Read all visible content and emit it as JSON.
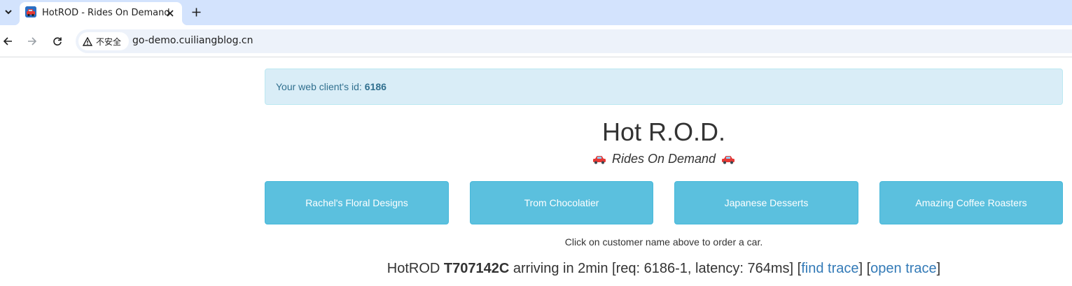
{
  "browser": {
    "tab_title": "HotROD - Rides On Demand",
    "security_label": "不安全",
    "url": "go-demo.cuiliangblog.cn",
    "icons": [
      "tab-search-icon",
      "favicon-icon",
      "close-icon",
      "plus-icon",
      "back-arrow-icon",
      "forward-arrow-icon",
      "reload-icon",
      "warning-icon"
    ]
  },
  "alert": {
    "label": "Your web client's id:",
    "client_id": "6186"
  },
  "header": {
    "title": "Hot R.O.D.",
    "subtitle": "Rides On Demand"
  },
  "customers": [
    {
      "name": "Rachel's Floral Designs"
    },
    {
      "name": "Trom Chocolatier"
    },
    {
      "name": "Japanese Desserts"
    },
    {
      "name": "Amazing Coffee Roasters"
    }
  ],
  "hint": "Click on customer name above to order a car.",
  "log": {
    "prefix": "HotROD",
    "driver": "T707142C",
    "middle": "arriving in 2min [req: 6186-1, latency: 764ms] [",
    "find_trace": "find trace",
    "sep": "] [",
    "open_trace": "open trace",
    "suffix": "]"
  },
  "colors": {
    "tab_strip": "#d3e3fd",
    "alert_bg": "#d9edf7",
    "alert_text": "#31708f",
    "button_bg": "#5bc0de",
    "link": "#337ab7"
  }
}
